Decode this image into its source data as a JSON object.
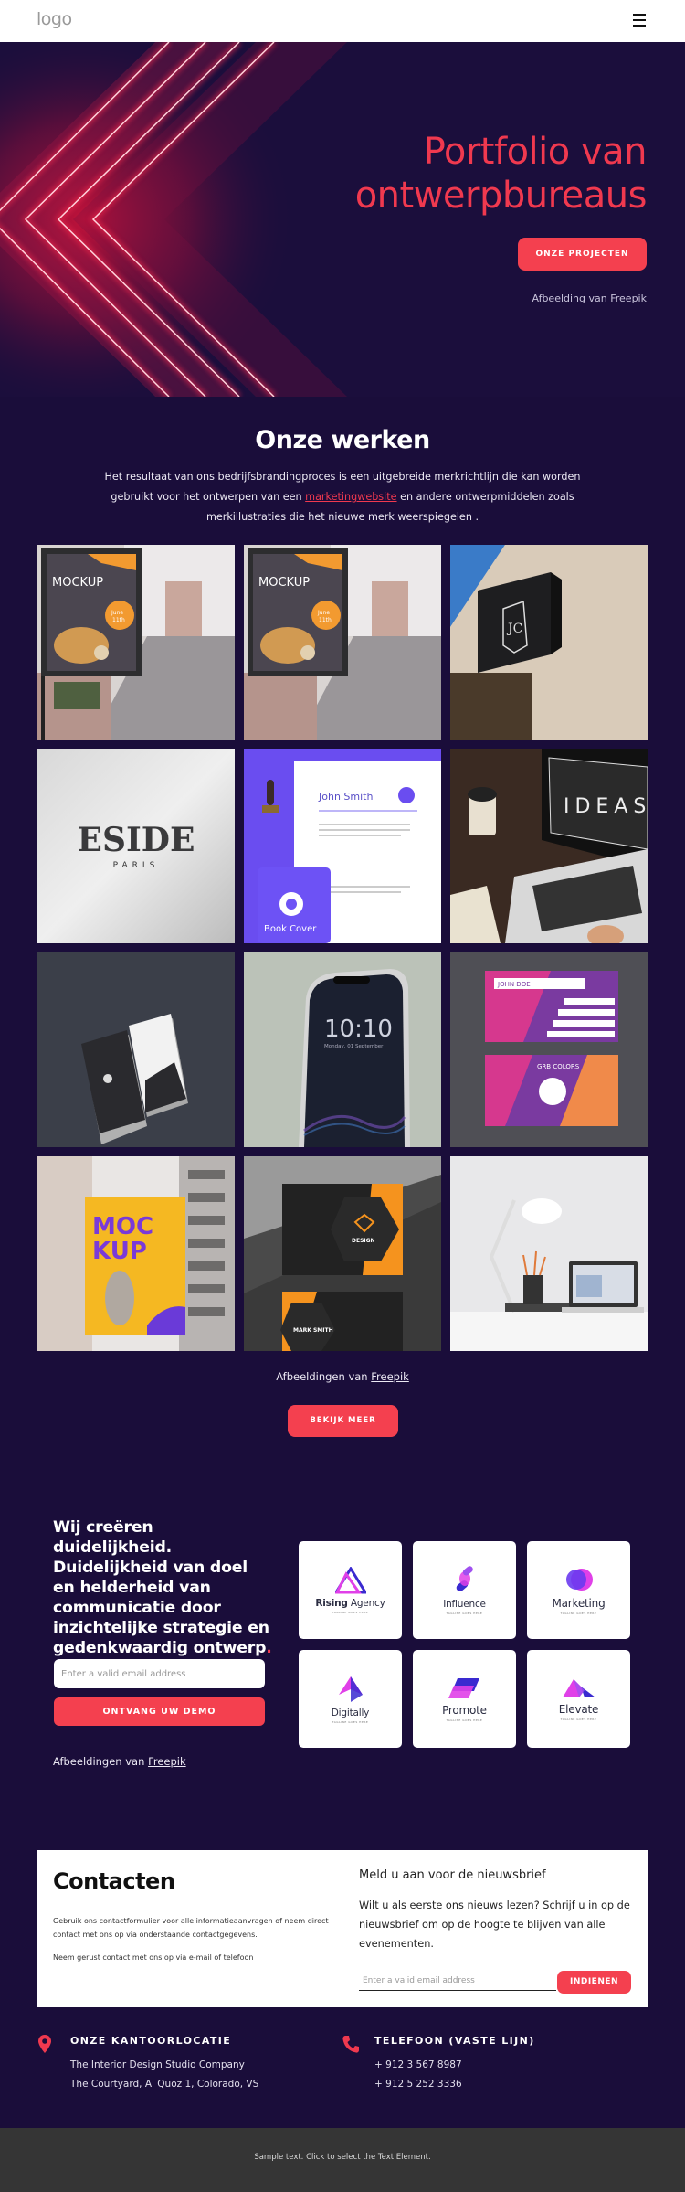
{
  "header": {
    "logo_text": "logo",
    "menu_icon": "hamburger-icon"
  },
  "hero": {
    "title_line1": "Portfolio van",
    "title_line2": "ontwerpbureaus",
    "cta_label": "ONZE PROJECTEN",
    "credit_prefix": "Afbeelding van ",
    "credit_link": "Freepik"
  },
  "works": {
    "title": "Onze werken",
    "desc_before": "Het resultaat van ons bedrijfsbrandingproces is een uitgebreide merkrichtlijn die kan worden gebruikt voor het ontwerpen van een ",
    "desc_link": "marketingwebsite",
    "desc_after": " en andere ontwerpmiddelen zoals merkillustraties die het nieuwe merk weerspiegelen .",
    "gallery": [
      {
        "name": "street-poster-mockup",
        "caption": "MOCKUP",
        "sub": "June 11th"
      },
      {
        "name": "street-poster-mockup-2",
        "caption": "MOCKUP",
        "sub": "June 11th"
      },
      {
        "name": "shop-sign-mockup",
        "caption": "JC",
        "sub": ""
      },
      {
        "name": "eside-paris-wall-logo",
        "caption": "ESIDE",
        "sub": "PARIS"
      },
      {
        "name": "stationery-book-cover",
        "caption": "Book Cover",
        "sub": "John Smith"
      },
      {
        "name": "laptop-ideas",
        "caption": "IDEAS",
        "sub": ""
      },
      {
        "name": "business-cards-dark",
        "caption": "",
        "sub": ""
      },
      {
        "name": "phone-lockscreen",
        "caption": "10:10",
        "sub": "Monday, 01 September"
      },
      {
        "name": "business-cards-pink",
        "caption": "JOHN DOE",
        "sub": "GRB COLORS"
      },
      {
        "name": "billboard-mockup",
        "caption": "MOC KUP",
        "sub": ""
      },
      {
        "name": "business-cards-orange",
        "caption": "DESIGN",
        "sub": "MARK SMITH"
      },
      {
        "name": "desk-lamp-laptop",
        "caption": "",
        "sub": ""
      }
    ],
    "credit_prefix": "Afbeeldingen van ",
    "credit_link": "Freepik",
    "more_label": "BEKIJK MEER"
  },
  "clarity": {
    "title": "Wij creëren duidelijkheid. Duidelijkheid van doel en helderheid van communicatie door inzichtelijke strategie en gedenkwaardig ontwerp",
    "title_dot": ".",
    "email_placeholder": "Enter a valid email address",
    "demo_label": "ONTVANG UW DEMO",
    "credit_prefix": "Afbeeldingen van ",
    "credit_link": "Freepik",
    "logos": [
      {
        "name": "Rising",
        "name2": " Agency",
        "tag": "TAGLINE GOES HERE"
      },
      {
        "name": "Influence",
        "name2": "",
        "tag": "TAGLINE GOES HERE"
      },
      {
        "name": "Marketing",
        "name2": "",
        "tag": "TAGLINE GOES HERE"
      },
      {
        "name": "Digitally",
        "name2": "",
        "tag": "TAGLINE GOES HERE"
      },
      {
        "name": "Promote",
        "name2": "",
        "tag": "TAGLINE GOES HERE"
      },
      {
        "name": "Elevate",
        "name2": "",
        "tag": "TAGLINE GOES HERE"
      }
    ]
  },
  "contacts": {
    "title": "Contacten",
    "p1": "Gebruik ons contactformulier voor alle informatieaanvragen of neem direct contact met ons op via onderstaande contactgegevens.",
    "p2": "Neem gerust contact met ons op via e-mail of telefoon",
    "newsletter_title": "Meld u aan voor de nieuwsbrief",
    "newsletter_desc": "Wilt u als eerste ons nieuws lezen? Schrijf u in op de nieuwsbrief om op de hoogte te blijven van alle evenementen.",
    "newsletter_placeholder": "Enter a valid email address",
    "submit_label": "INDIENEN"
  },
  "office": {
    "heading": "ONZE KANTOORLOCATIE",
    "line1": "The Interior Design Studio Company",
    "line2": "The Courtyard, Al Quoz 1, Colorado,  VS",
    "icon": "map-pin-icon"
  },
  "phone": {
    "heading": "TELEFOON (VASTE LIJN)",
    "line1": "+ 912 3 567 8987",
    "line2": "+ 912 5 252 3336",
    "icon": "phone-icon"
  },
  "footer": {
    "text": "Sample text. Click to select the Text Element."
  },
  "colors": {
    "accent": "#f4404f",
    "background": "#1a0d3a",
    "footer": "#353535"
  }
}
